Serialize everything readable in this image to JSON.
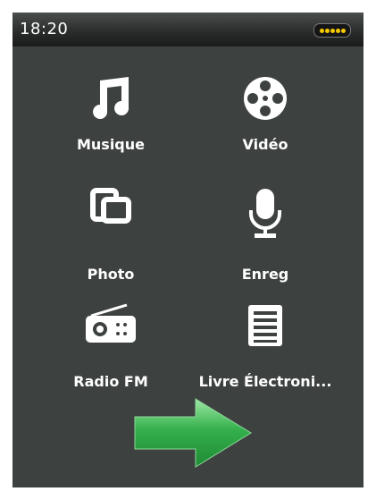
{
  "status": {
    "time": "18:20",
    "battery_level": 5,
    "battery_dot_color": "#f5c900"
  },
  "menu": {
    "items": [
      {
        "label": "Musique",
        "icon": "music-note-icon"
      },
      {
        "label": "Vidéo",
        "icon": "film-reel-icon"
      },
      {
        "label": "Photo",
        "icon": "photos-icon"
      },
      {
        "label": "Enreg",
        "icon": "microphone-icon"
      },
      {
        "label": "Radio FM",
        "icon": "radio-icon"
      },
      {
        "label": "Livre Électroni...",
        "icon": "document-icon"
      }
    ]
  },
  "navigation": {
    "next_icon": "arrow-right-icon",
    "arrow_color": "#2ea84a"
  },
  "colors": {
    "background": "#3d4240",
    "icon": "#ffffff",
    "label": "#ffffff"
  }
}
